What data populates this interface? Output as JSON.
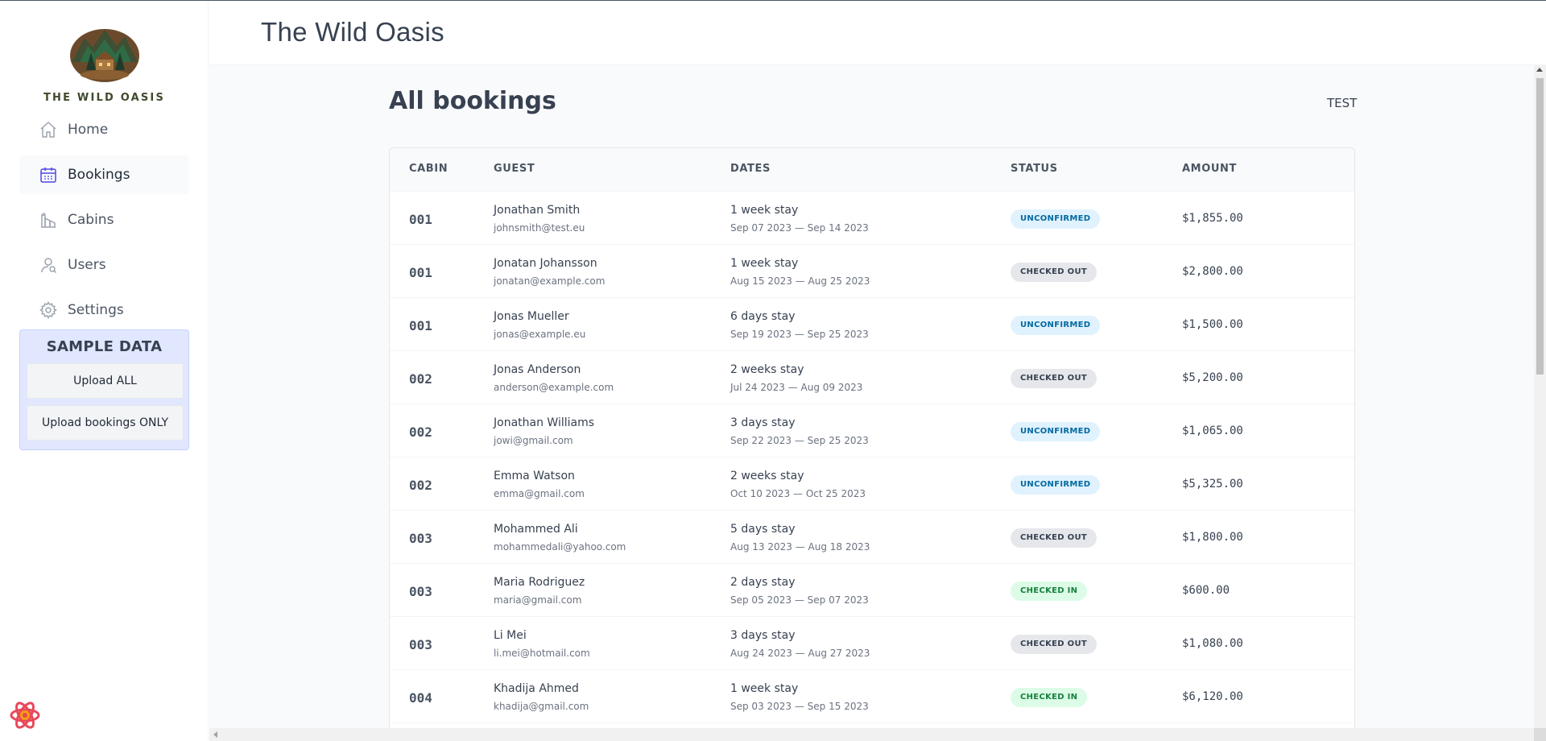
{
  "sidebar": {
    "brand": "THE WILD OASIS",
    "items": [
      {
        "label": "Home",
        "icon": "home-icon"
      },
      {
        "label": "Bookings",
        "icon": "calendar-icon",
        "active": true
      },
      {
        "label": "Cabins",
        "icon": "cabins-icon"
      },
      {
        "label": "Users",
        "icon": "users-icon"
      },
      {
        "label": "Settings",
        "icon": "gear-icon"
      }
    ],
    "sample": {
      "title": "SAMPLE DATA",
      "upload_all": "Upload ALL",
      "upload_bookings": "Upload bookings ONLY"
    }
  },
  "header": {
    "title": "The Wild Oasis"
  },
  "main": {
    "title": "All bookings",
    "filter_label": "TEST",
    "columns": [
      "CABIN",
      "GUEST",
      "DATES",
      "STATUS",
      "AMOUNT"
    ],
    "rows": [
      {
        "cabin": "001",
        "name": "Jonathan Smith",
        "email": "johnsmith@test.eu",
        "stay": "1 week stay",
        "range": "Sep 07 2023 — Sep 14 2023",
        "status": "UNCONFIRMED",
        "amount": "$1,855.00"
      },
      {
        "cabin": "001",
        "name": "Jonatan Johansson",
        "email": "jonatan@example.com",
        "stay": "1 week stay",
        "range": "Aug 15 2023 — Aug 25 2023",
        "status": "CHECKED OUT",
        "amount": "$2,800.00"
      },
      {
        "cabin": "001",
        "name": "Jonas Mueller",
        "email": "jonas@example.eu",
        "stay": "6 days stay",
        "range": "Sep 19 2023 — Sep 25 2023",
        "status": "UNCONFIRMED",
        "amount": "$1,500.00"
      },
      {
        "cabin": "002",
        "name": "Jonas Anderson",
        "email": "anderson@example.com",
        "stay": "2 weeks stay",
        "range": "Jul 24 2023 — Aug 09 2023",
        "status": "CHECKED OUT",
        "amount": "$5,200.00"
      },
      {
        "cabin": "002",
        "name": "Jonathan Williams",
        "email": "jowi@gmail.com",
        "stay": "3 days stay",
        "range": "Sep 22 2023 — Sep 25 2023",
        "status": "UNCONFIRMED",
        "amount": "$1,065.00"
      },
      {
        "cabin": "002",
        "name": "Emma Watson",
        "email": "emma@gmail.com",
        "stay": "2 weeks stay",
        "range": "Oct 10 2023 — Oct 25 2023",
        "status": "UNCONFIRMED",
        "amount": "$5,325.00"
      },
      {
        "cabin": "003",
        "name": "Mohammed Ali",
        "email": "mohammedali@yahoo.com",
        "stay": "5 days stay",
        "range": "Aug 13 2023 — Aug 18 2023",
        "status": "CHECKED OUT",
        "amount": "$1,800.00"
      },
      {
        "cabin": "003",
        "name": "Maria Rodriguez",
        "email": "maria@gmail.com",
        "stay": "2 days stay",
        "range": "Sep 05 2023 — Sep 07 2023",
        "status": "CHECKED IN",
        "amount": "$600.00"
      },
      {
        "cabin": "003",
        "name": "Li Mei",
        "email": "li.mei@hotmail.com",
        "stay": "3 days stay",
        "range": "Aug 24 2023 — Aug 27 2023",
        "status": "CHECKED OUT",
        "amount": "$1,080.00"
      },
      {
        "cabin": "004",
        "name": "Khadija Ahmed",
        "email": "khadija@gmail.com",
        "stay": "1 week stay",
        "range": "Sep 03 2023 — Sep 15 2023",
        "status": "CHECKED IN",
        "amount": "$6,120.00"
      }
    ]
  },
  "colors": {
    "accent": "#4f46e5",
    "unconfirmed_bg": "#e0f2fe",
    "checked_out_bg": "#e5e7eb",
    "checked_in_bg": "#dcfce7"
  }
}
